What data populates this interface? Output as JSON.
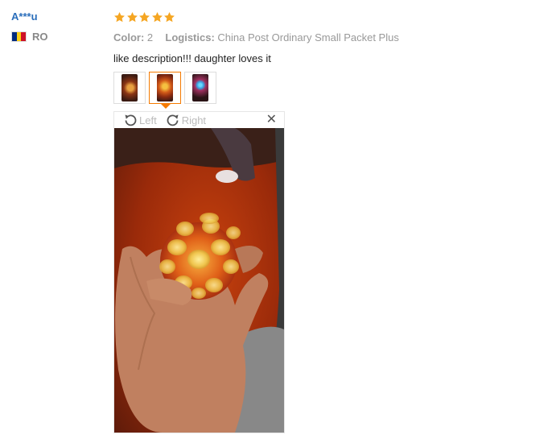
{
  "user": {
    "name": "A***u",
    "country_code": "RO",
    "flag_colors": [
      "#002b7f",
      "#fcd116",
      "#ce1126"
    ]
  },
  "rating": {
    "stars": 5,
    "max": 5,
    "color": "#f5a623"
  },
  "attributes": {
    "color_label": "Color:",
    "color_value": "2",
    "logistics_label": "Logistics:",
    "logistics_value": "China Post Ordinary Small Packet Plus"
  },
  "comment": "like description!!! daughter loves it",
  "thumbnails": [
    {
      "name": "photo-thumbnail-1",
      "active": false
    },
    {
      "name": "photo-thumbnail-2",
      "active": true
    },
    {
      "name": "photo-thumbnail-3",
      "active": false
    }
  ],
  "viewer": {
    "rotate_left_label": "Left",
    "rotate_right_label": "Right",
    "close_icon": "close-icon",
    "accent_color": "#f57a00"
  }
}
